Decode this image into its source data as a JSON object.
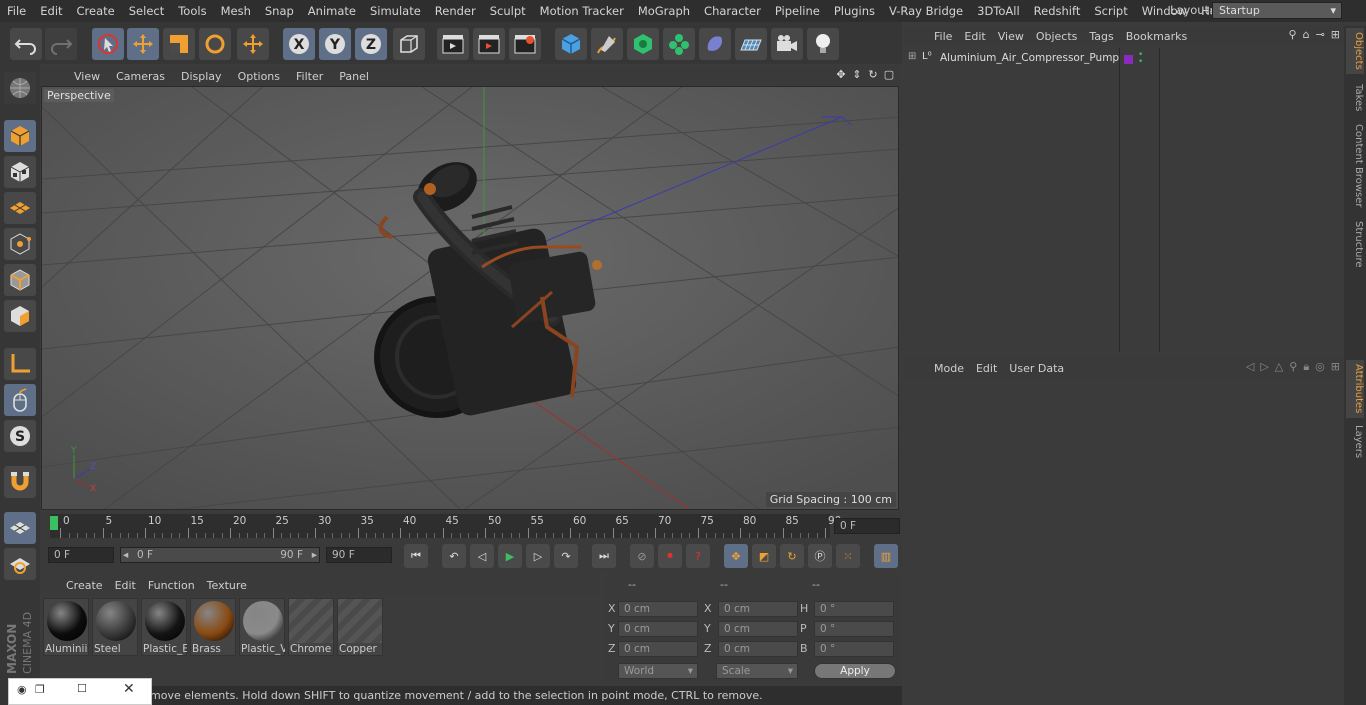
{
  "menu": [
    "File",
    "Edit",
    "Create",
    "Select",
    "Tools",
    "Mesh",
    "Snap",
    "Animate",
    "Simulate",
    "Render",
    "Sculpt",
    "Motion Tracker",
    "MoGraph",
    "Character",
    "Pipeline",
    "Plugins",
    "V-Ray Bridge",
    "3DToAll",
    "Redshift",
    "Script",
    "Window",
    "Help"
  ],
  "layout": {
    "label": "Layout:",
    "value": "Startup"
  },
  "viewport": {
    "menu": [
      "View",
      "Cameras",
      "Display",
      "Options",
      "Filter",
      "Panel"
    ],
    "camera_label": "Perspective",
    "grid_spacing": "Grid Spacing : 100 cm"
  },
  "timeline": {
    "ticks": [
      "0",
      "5",
      "10",
      "15",
      "20",
      "25",
      "30",
      "35",
      "40",
      "45",
      "50",
      "55",
      "60",
      "65",
      "70",
      "75",
      "80",
      "85",
      "90"
    ],
    "current_frame": "0 F",
    "start_frame": "0 F",
    "range_start": "0 F",
    "range_end": "90 F",
    "end_frame": "90 F"
  },
  "materials": {
    "menu": [
      "Create",
      "Edit",
      "Function",
      "Texture"
    ],
    "items": [
      {
        "name": "Aluminii",
        "color": "#0c0c0c"
      },
      {
        "name": "Steel",
        "color": "#3a3a3a"
      },
      {
        "name": "Plastic_E",
        "color": "#141414"
      },
      {
        "name": "Brass",
        "color": "#8a4a12"
      },
      {
        "name": "Plastic_V",
        "color": "#8a8a8a"
      },
      {
        "name": "Chrome",
        "color": ""
      },
      {
        "name": "Copper",
        "color": ""
      }
    ]
  },
  "coords": {
    "headers": [
      "--",
      "--",
      "--"
    ],
    "rows": [
      {
        "a": "X",
        "av": "0 cm",
        "b": "X",
        "bv": "0 cm",
        "c": "H",
        "cv": "0 °"
      },
      {
        "a": "Y",
        "av": "0 cm",
        "b": "Y",
        "bv": "0 cm",
        "c": "P",
        "cv": "0 °"
      },
      {
        "a": "Z",
        "av": "0 cm",
        "b": "Z",
        "bv": "0 cm",
        "c": "B",
        "cv": "0 °"
      }
    ],
    "world": "World",
    "scale": "Scale",
    "apply": "Apply"
  },
  "objects": {
    "menu": [
      "File",
      "Edit",
      "View",
      "Objects",
      "Tags",
      "Bookmarks"
    ],
    "items": [
      {
        "name": "Aluminium_Air_Compressor_Pump"
      }
    ]
  },
  "attributes": {
    "menu": [
      "Mode",
      "Edit",
      "User Data"
    ]
  },
  "side_tabs": [
    "Objects",
    "Takes",
    "Content Browser",
    "Structure",
    "Attributes",
    "Layers"
  ],
  "status": "move elements. Hold down SHIFT to quantize movement / add to the selection in point mode, CTRL to remove.",
  "brand": "MAXON CINEMA 4D"
}
